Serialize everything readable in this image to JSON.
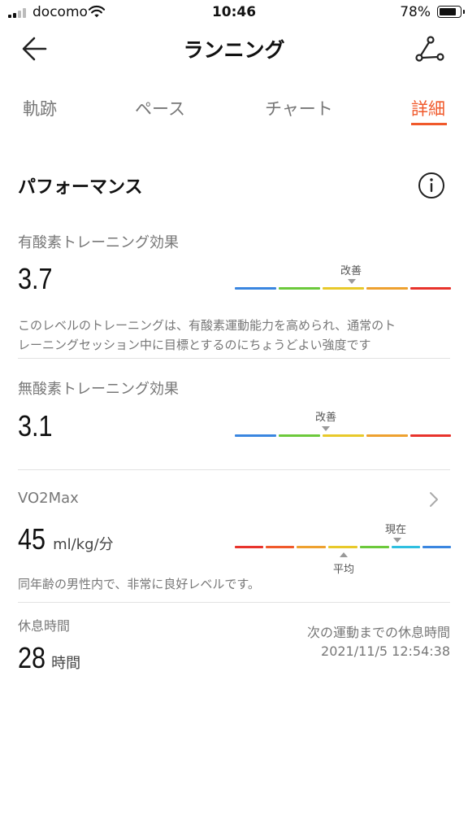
{
  "status_bar": {
    "carrier": "docomo",
    "time": "10:46",
    "battery": "78%"
  },
  "header": {
    "title": "ランニング"
  },
  "tabs": [
    {
      "label": "軌跡"
    },
    {
      "label": "ペース"
    },
    {
      "label": "チャート"
    },
    {
      "label": "詳細"
    }
  ],
  "performance": {
    "title": "パフォーマンス",
    "aerobic": {
      "label": "有酸素トレーニング効果",
      "value": "3.7",
      "marker_label": "改善",
      "desc_line1": "このレベルのトレーニングは、有酸素運動能力を高められ、通常のト",
      "desc_line2": "レーニングセッション中に目標とするのにちょうどよい強度です"
    },
    "anaerobic": {
      "label": "無酸素トレーニング効果",
      "value": "3.1",
      "marker_label": "改善"
    },
    "vo2max": {
      "label": "VO2Max",
      "value": "45",
      "unit": "ml/kg/分",
      "current_label": "現在",
      "average_label": "平均",
      "desc": "同年齢の男性内で、非常に良好レベルです。"
    },
    "rest": {
      "label": "休息時間",
      "value": "28",
      "unit": "時間",
      "next_label": "次の運動までの休息時間",
      "next_time": "2021/11/5 12:54:38"
    }
  },
  "colors": {
    "accent": "#f0592b",
    "blue": "#3a86e0",
    "green": "#6cc93b",
    "yellow": "#e8c92a",
    "orange": "#eea12f",
    "red": "#e8332c",
    "cyan": "#2fbfe0"
  },
  "icons": {
    "back": "arrow-left-icon",
    "route": "route-icon",
    "info": "info-icon",
    "chevron": "chevron-right-icon"
  }
}
